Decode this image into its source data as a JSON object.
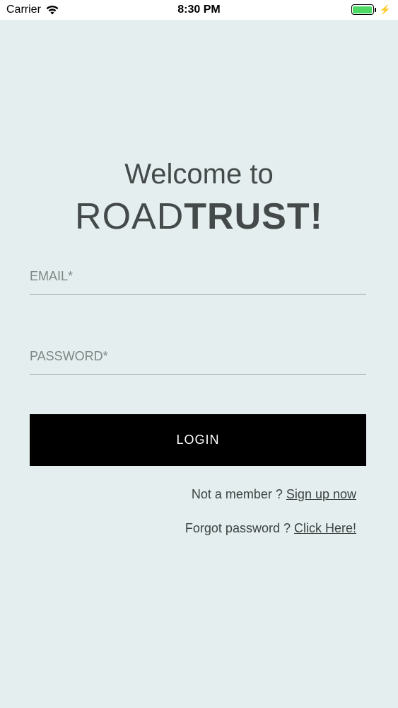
{
  "status_bar": {
    "carrier": "Carrier",
    "time": "8:30 PM",
    "battery_level": 1.0,
    "battery_color": "#4cd964"
  },
  "heading": {
    "welcome": "Welcome to",
    "brand_light": "ROAD",
    "brand_bold": "TRUST!"
  },
  "form": {
    "email_placeholder": "EMAIL*",
    "email_value": "",
    "password_placeholder": "PASSWORD*",
    "password_value": "",
    "login_label": "LOGIN"
  },
  "links": {
    "signup_prompt": "Not a member ? ",
    "signup_link": "Sign up now",
    "forgot_prompt": "Forgot password ? ",
    "forgot_link": "Click Here!"
  },
  "colors": {
    "background": "#e4eeee",
    "button": "#000000",
    "text": "#444a49"
  },
  "icons": [
    "wifi-icon",
    "battery-icon",
    "charging-bolt-icon"
  ]
}
